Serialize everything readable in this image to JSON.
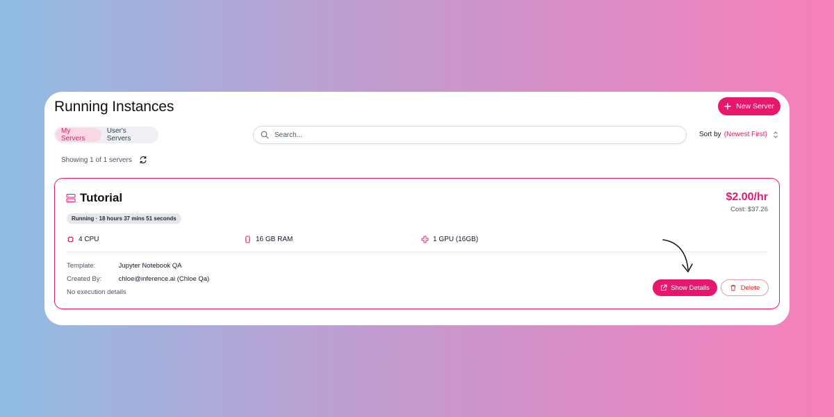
{
  "header": {
    "title": "Running Instances",
    "new_server_label": "New Server"
  },
  "tabs": [
    {
      "label": "My Servers",
      "active": true
    },
    {
      "label": "User's Servers",
      "active": false
    }
  ],
  "search": {
    "placeholder": "Search...",
    "value": ""
  },
  "sort": {
    "label": "Sort by",
    "value": "(Newest First)"
  },
  "summary": {
    "showing_text": "Showing 1 of 1 servers"
  },
  "instance": {
    "name": "Tutorial",
    "status": "Running · 18 hours 37 mins 51 seconds",
    "rate": "$2.00/hr",
    "cost": "Cost: $37.26",
    "specs": {
      "cpu": "4 CPU",
      "ram": "16 GB RAM",
      "gpu": "1 GPU (16GB)"
    },
    "template_label": "Template:",
    "template_value": "Jupyter Notebook QA",
    "created_by_label": "Created By:",
    "created_by_value": "chloe@inference.ai (Chloe Qa)",
    "execution_text": "No execution details",
    "show_details_label": "Show Details",
    "delete_label": "Delete"
  },
  "colors": {
    "accent": "#e8176e",
    "delete": "#dc2626",
    "panel_bg": "#ffffff"
  },
  "icons": {
    "new_server": "plus-icon",
    "search": "search-icon",
    "sort": "sort-icon",
    "refresh": "refresh-icon",
    "server": "server-icon",
    "cpu": "cpu-icon",
    "ram": "memory-icon",
    "gpu": "gpu-icon",
    "show_details": "external-link-icon",
    "delete": "trash-icon"
  }
}
